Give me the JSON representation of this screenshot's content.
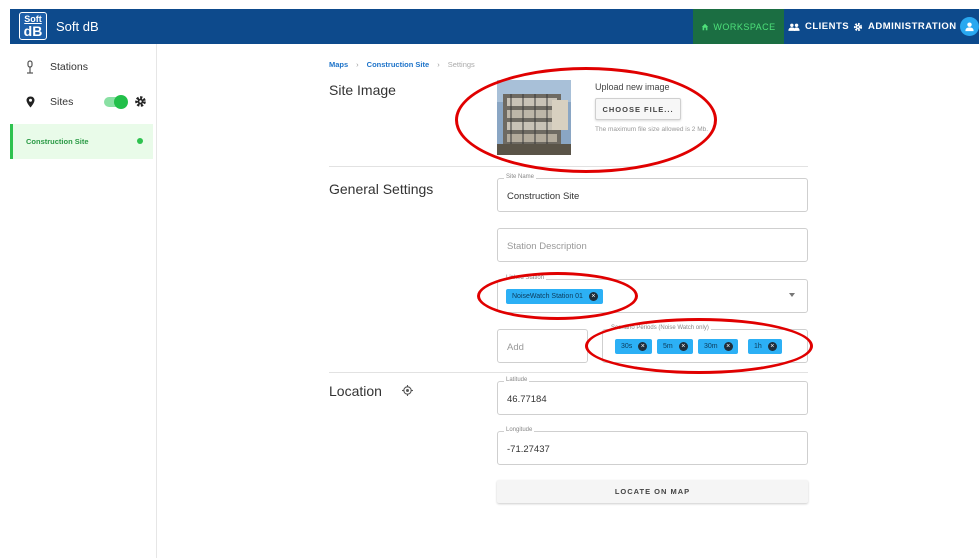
{
  "header": {
    "logo_top": "Soft",
    "logo_bottom": "dB",
    "app_title": "Soft dB",
    "nav": {
      "workspace": "WORKSPACE",
      "clients": "CLIENTS",
      "administration": "ADMINISTRATION"
    },
    "colors": {
      "bar": "#0d4a8c",
      "workspace_bg": "#1b6e42",
      "workspace_text": "#4ee07a"
    }
  },
  "sidebar": {
    "stations_label": "Stations",
    "sites_label": "Sites",
    "sites_toggle_on": true,
    "active_site": "Construction Site"
  },
  "breadcrumb": {
    "maps": "Maps",
    "site": "Construction Site",
    "current": "Settings"
  },
  "site_image": {
    "title": "Site Image",
    "upload_label": "Upload new image",
    "choose_file": "CHOOSE FILE...",
    "hint": "The maximum file size allowed is 2 Mb."
  },
  "general": {
    "title": "General Settings",
    "site_name_label": "Site Name",
    "site_name_value": "Construction Site",
    "station_description_placeholder": "Station Description",
    "linked_station_label": "Linked Station",
    "linked_station_chip": "NoiseWatch Station 01",
    "add_placeholder": "Add",
    "scenario_label": "Scenario Periods (Noise Watch only)",
    "scenario_chips": [
      "30s",
      "5m",
      "30m",
      "1h"
    ]
  },
  "location": {
    "title": "Location",
    "latitude_label": "Latitude",
    "latitude_value": "46.77184",
    "longitude_label": "Longitude",
    "longitude_value": "-71.27437",
    "locate_button": "LOCATE ON MAP"
  },
  "annotation_color": "#e00000",
  "accent": "#2cb0f5"
}
